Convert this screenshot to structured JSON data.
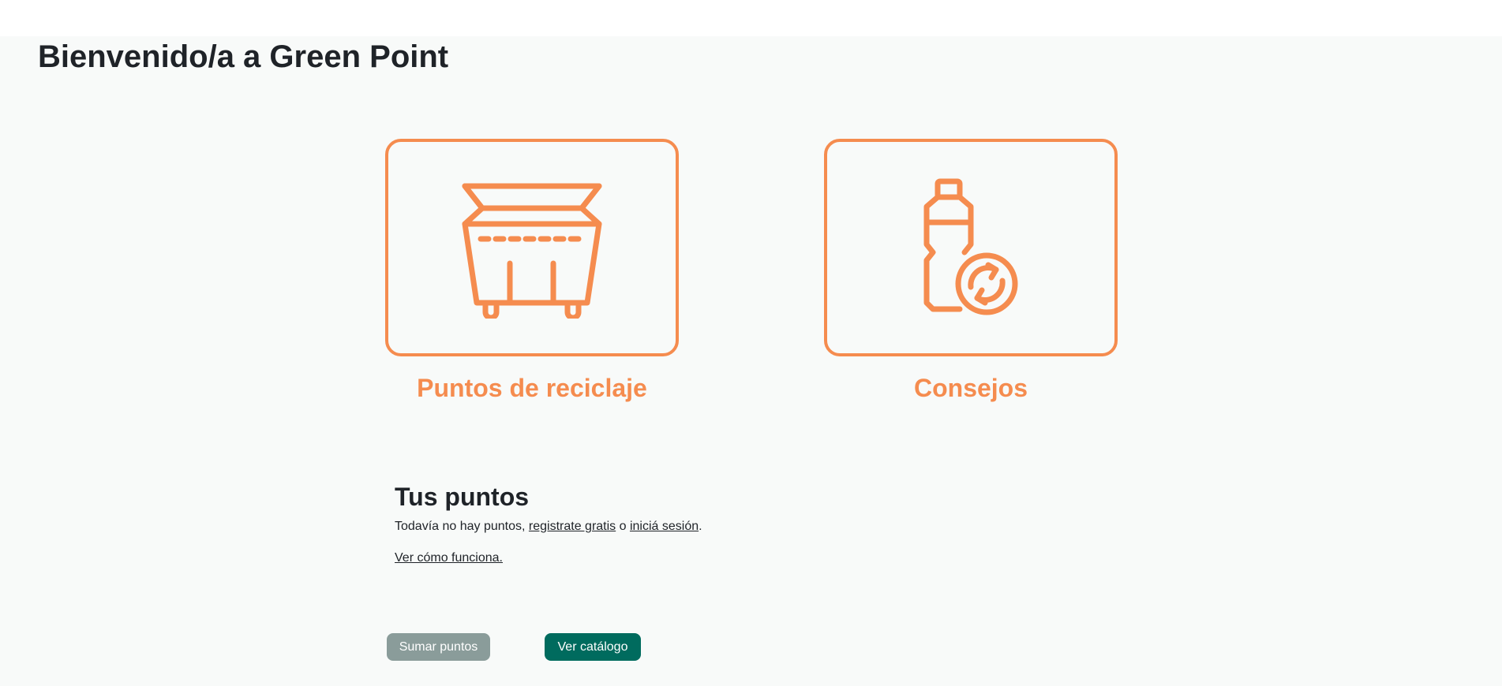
{
  "page": {
    "title": "Bienvenido/a a Green Point"
  },
  "cards": {
    "recycle": {
      "label": "Puntos de reciclaje",
      "icon": "recycling-bin-icon"
    },
    "tips": {
      "label": "Consejos",
      "icon": "recycle-bottle-icon"
    }
  },
  "points": {
    "title": "Tus puntos",
    "text_prefix": "Todavía no hay puntos, ",
    "register_link": "registrate gratis",
    "text_middle": " o ",
    "login_link": "iniciá sesión",
    "text_suffix": ".",
    "how_link": "Ver cómo funciona."
  },
  "buttons": {
    "add_points": "Sumar puntos",
    "catalog": "Ver catálogo"
  },
  "colors": {
    "accent": "#f58c4f",
    "primary": "#006b5e",
    "disabled": "#8a9c9a",
    "background": "#f8faf9"
  }
}
